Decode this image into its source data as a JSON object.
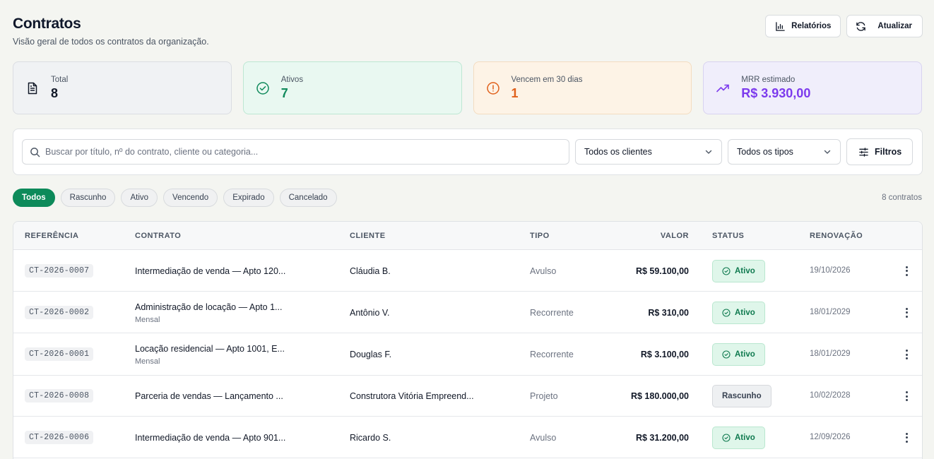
{
  "header": {
    "title": "Contratos",
    "subtitle": "Visão geral de todos os contratos da organização.",
    "reports_label": "Relatórios",
    "refresh_label": "Atualizar"
  },
  "stats": [
    {
      "label": "Total",
      "value": "8",
      "icon": "file-text-icon"
    },
    {
      "label": "Ativos",
      "value": "7",
      "icon": "check-circle-icon"
    },
    {
      "label": "Vencem em 30 dias",
      "value": "1",
      "icon": "alert-circle-icon"
    },
    {
      "label": "MRR estimado",
      "value": "R$ 3.930,00",
      "icon": "trending-up-icon"
    }
  ],
  "filters": {
    "search_placeholder": "Buscar por título, nº do contrato, cliente ou categoria...",
    "clients_selected": "Todos os clientes",
    "types_selected": "Todos os tipos",
    "filters_label": "Filtros"
  },
  "status_tabs": [
    "Todos",
    "Rascunho",
    "Ativo",
    "Vencendo",
    "Expirado",
    "Cancelado"
  ],
  "active_tab": "Todos",
  "count_label": "8 contratos",
  "table": {
    "columns": [
      "REFERÊNCIA",
      "CONTRATO",
      "CLIENTE",
      "TIPO",
      "VALOR",
      "STATUS",
      "RENOVAÇÃO"
    ],
    "rows": [
      {
        "ref": "CT-2026-0007",
        "title": "Intermediação de venda — Apto 120...",
        "subtitle": "",
        "client": "Cláudia B.",
        "type": "Avulso",
        "value": "R$ 59.100,00",
        "status": "Ativo",
        "renewal": "19/10/2026"
      },
      {
        "ref": "CT-2026-0002",
        "title": "Administração de locação — Apto 1...",
        "subtitle": "Mensal",
        "client": "Antônio V.",
        "type": "Recorrente",
        "value": "R$ 310,00",
        "status": "Ativo",
        "renewal": "18/01/2029"
      },
      {
        "ref": "CT-2026-0001",
        "title": "Locação residencial — Apto 1001, E...",
        "subtitle": "Mensal",
        "client": "Douglas F.",
        "type": "Recorrente",
        "value": "R$ 3.100,00",
        "status": "Ativo",
        "renewal": "18/01/2029"
      },
      {
        "ref": "CT-2026-0008",
        "title": "Parceria de vendas — Lançamento ...",
        "subtitle": "",
        "client": "Construtora Vitória Empreend...",
        "type": "Projeto",
        "value": "R$ 180.000,00",
        "status": "Rascunho",
        "renewal": "10/02/2028"
      },
      {
        "ref": "CT-2026-0006",
        "title": "Intermediação de venda — Apto 901...",
        "subtitle": "",
        "client": "Ricardo S.",
        "type": "Avulso",
        "value": "R$ 31.200,00",
        "status": "Ativo",
        "renewal": "12/09/2026"
      }
    ]
  }
}
